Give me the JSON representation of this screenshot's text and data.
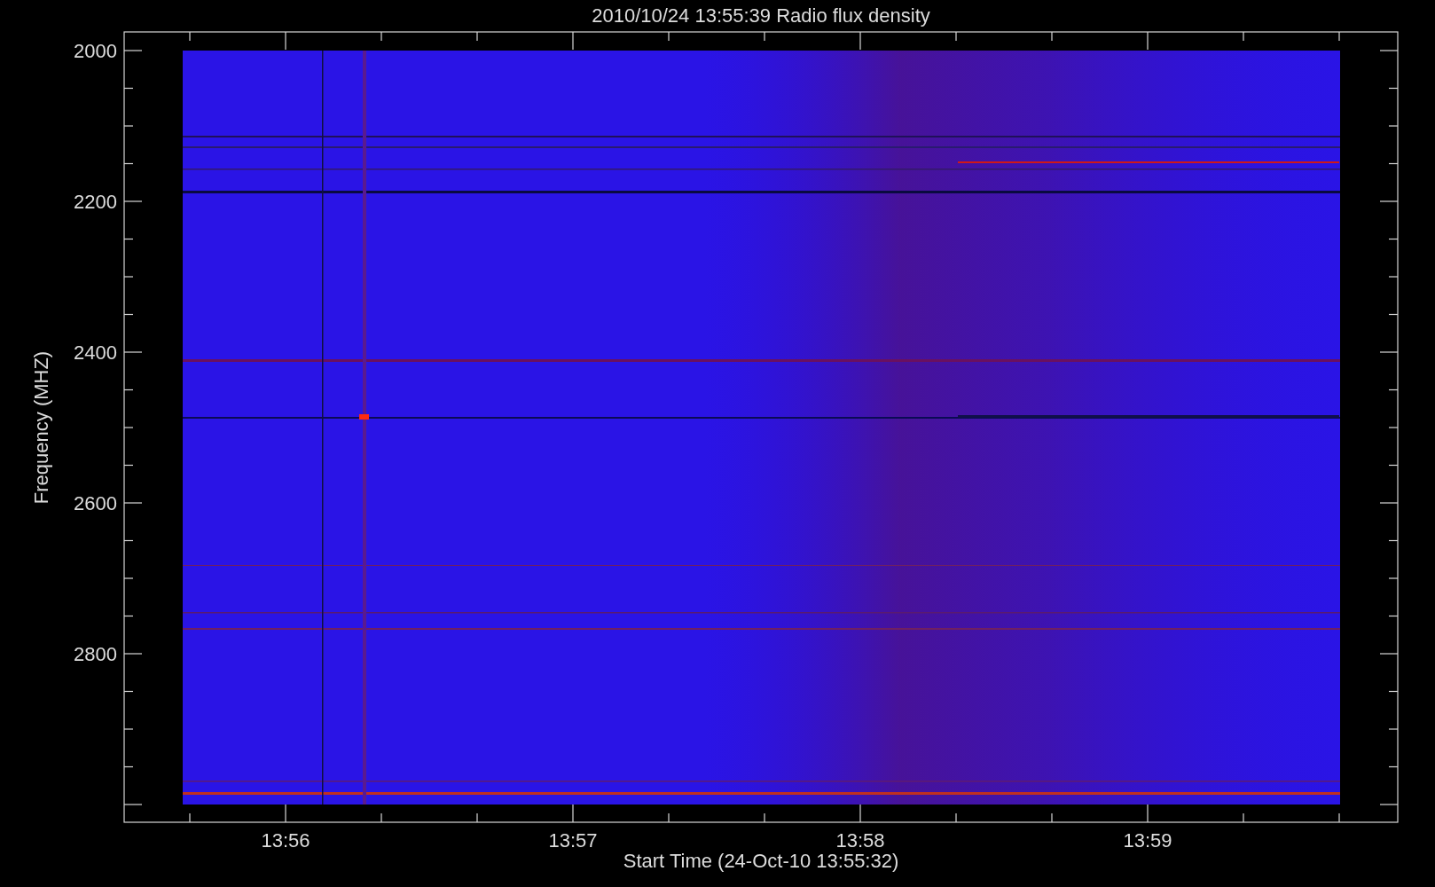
{
  "title": "2010/10/24 13:55:39 Radio flux density",
  "y_axis": {
    "label": "Frequency (MHZ)",
    "ticks": [
      "2000",
      "2200",
      "2400",
      "2600",
      "2800"
    ]
  },
  "x_axis": {
    "label": "Start Time (24-Oct-10 13:55:32)",
    "ticks": [
      "13:56",
      "13:57",
      "13:58",
      "13:59"
    ]
  }
}
